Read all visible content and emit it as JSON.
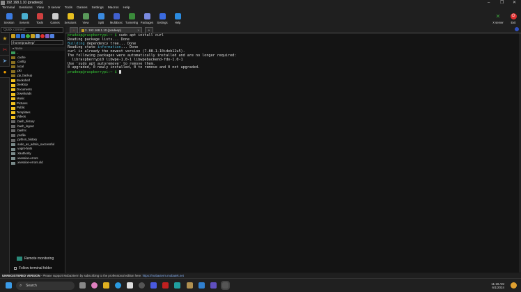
{
  "window": {
    "title": "192.168.1.10 (pradeep)"
  },
  "menu": [
    "Terminal",
    "Sessions",
    "View",
    "X server",
    "Tools",
    "Games",
    "Settings",
    "Macros",
    "Help"
  ],
  "toolbar": [
    {
      "label": "Session",
      "icon": "session-icon",
      "color": "#3b7be0"
    },
    {
      "label": "Servers",
      "icon": "servers-icon",
      "color": "#4ab0d0"
    },
    {
      "label": "Tools",
      "icon": "tools-icon",
      "color": "#d04040"
    },
    {
      "label": "Games",
      "icon": "games-icon",
      "color": "#cccccc"
    },
    {
      "label": "Sessions",
      "icon": "star-icon",
      "color": "#e8c020"
    },
    {
      "label": "View",
      "icon": "view-icon",
      "color": "#5a9a5a"
    },
    {
      "label": "Split",
      "icon": "split-icon",
      "color": "#3b8be0"
    },
    {
      "label": "MultiExec",
      "icon": "multiexec-icon",
      "color": "#4060d0"
    },
    {
      "label": "Tunneling",
      "icon": "tunneling-icon",
      "color": "#3a8a3a"
    },
    {
      "label": "Packages",
      "icon": "packages-icon",
      "color": "#7a8ae0"
    },
    {
      "label": "Settings",
      "icon": "settings-icon",
      "color": "#3b6be0"
    },
    {
      "label": "Help",
      "icon": "help-icon",
      "color": "#2b8be0"
    }
  ],
  "toolbar_right": [
    {
      "label": "X server",
      "icon": "xserver-icon"
    },
    {
      "label": "Exit",
      "icon": "exit-icon"
    }
  ],
  "quick_connect": {
    "placeholder": "Quick connect..."
  },
  "tabs": {
    "active": "2. 192.168.1.10 (pradeep)"
  },
  "file_panel": {
    "path": "/home/pradeep/",
    "column": "Name",
    "items": [
      {
        "name": "..",
        "type": "up"
      },
      {
        "name": ".cache",
        "type": "hidden-folder"
      },
      {
        "name": ".config",
        "type": "hidden-folder"
      },
      {
        "name": ".local",
        "type": "hidden-folder"
      },
      {
        "name": ".pki",
        "type": "hidden-folder"
      },
      {
        "name": ".pp_backup",
        "type": "hidden-folder"
      },
      {
        "name": "Bookshelf",
        "type": "folder"
      },
      {
        "name": "Desktop",
        "type": "folder"
      },
      {
        "name": "Documents",
        "type": "folder"
      },
      {
        "name": "Downloads",
        "type": "folder"
      },
      {
        "name": "Music",
        "type": "folder"
      },
      {
        "name": "Pictures",
        "type": "folder"
      },
      {
        "name": "Public",
        "type": "folder"
      },
      {
        "name": "Templates",
        "type": "folder"
      },
      {
        "name": "Videos",
        "type": "folder"
      },
      {
        "name": ".bash_history",
        "type": "file"
      },
      {
        "name": ".bash_logout",
        "type": "file"
      },
      {
        "name": ".bashrc",
        "type": "file"
      },
      {
        "name": ".profile",
        "type": "file"
      },
      {
        "name": ".python_history",
        "type": "file"
      },
      {
        "name": ".sudo_as_admin_successful",
        "type": "file2"
      },
      {
        "name": ".vugnt-hints",
        "type": "file2"
      },
      {
        "name": ".Xauthority",
        "type": "file2"
      },
      {
        "name": ".xsession-errors",
        "type": "file2"
      },
      {
        "name": ".xsession-errors.old",
        "type": "file2"
      }
    ],
    "remote_monitoring": "Remote monitoring",
    "follow_folder": "Follow terminal folder"
  },
  "terminal": {
    "prompt": "pradeep@raspberrypi:~ $",
    "command": " sudo apt install curl",
    "lines": [
      "Reading package lists... Done",
      "dependency tree... Done",
      "Reading state ",
      "curl is already the newest version (7.88.1-10+deb12u5).",
      "The following packages were automatically installed and are no longer required:",
      "  libraspberrypi0 libwpe-1.0-1 libwpebackend-fdo-1.0-1",
      "Use 'sudo apt autoremove' to remove them.",
      "0 upgraded, 0 newly installed, 0 to remove and 0 not upgraded."
    ],
    "building": "Building",
    "information": "information",
    "info_tail": "... Done"
  },
  "statusbar": {
    "version": "UNREGISTERED VERSION",
    "message": "  -  Please support MobaXterm by subscribing to the professional edition here:  ",
    "link": "https://mobaxterm.mobatek.net"
  },
  "taskbar": {
    "search": "Search",
    "time": "11:19 AM",
    "date": "6/1/2024"
  }
}
